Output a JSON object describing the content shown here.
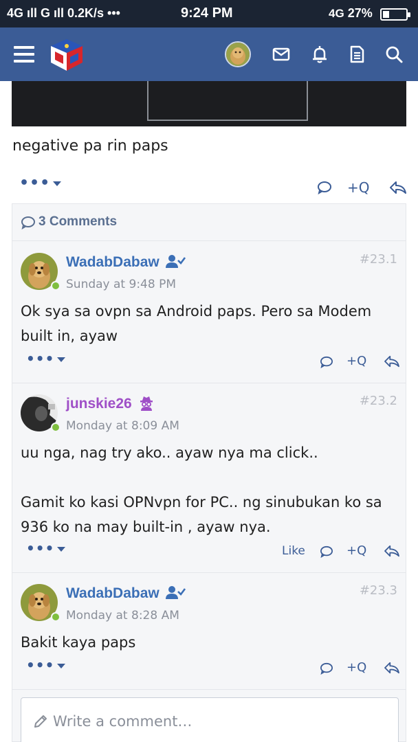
{
  "status_bar": {
    "left": "4G ıll  G ıll  0.2K/s •••",
    "time": "9:24 PM",
    "network": "4G",
    "battery": "27%",
    "battery_level": 0.27
  },
  "header": {
    "menu_icon": "hamburger-icon",
    "logo": "site-logo",
    "icons": [
      "avatar",
      "envelope-icon",
      "bell-icon",
      "document-icon",
      "search-icon"
    ]
  },
  "post": {
    "text": "negative pa rin paps",
    "more_label": "•••",
    "quote_label": "+Q"
  },
  "comments": {
    "title": "3 Comments",
    "items": [
      {
        "user": "WadabDabaw",
        "badge": "user-check-icon",
        "time": "Sunday at 9:48 PM",
        "number": "#23.1",
        "body": "Ok sya sa ovpn sa Android paps. Pero sa Modem built in, ayaw",
        "more_label": "•••",
        "quote_label": "+Q"
      },
      {
        "user": "junskie26",
        "badge": "spy-icon",
        "time": "Monday at 8:09 AM",
        "number": "#23.2",
        "body": "uu nga, nag try ako.. ayaw nya ma click..\n\nGamit ko kasi OPNvpn for PC.. ng sinubukan ko sa 936 ko na may built-in , ayaw nya.",
        "like_label": "Like",
        "more_label": "•••",
        "quote_label": "+Q"
      },
      {
        "user": "WadabDabaw",
        "badge": "user-check-icon",
        "time": "Monday at 8:28 AM",
        "number": "#23.3",
        "body": "Bakit kaya paps",
        "more_label": "•••",
        "quote_label": "+Q"
      }
    ],
    "write_placeholder": "Write a comment…"
  },
  "colors": {
    "header_bg": "#3b5c96",
    "status_bg": "#1b2433",
    "link_blue": "#3b6fb6",
    "purple_user": "#9f4fc7",
    "online": "#7fbf3f"
  }
}
